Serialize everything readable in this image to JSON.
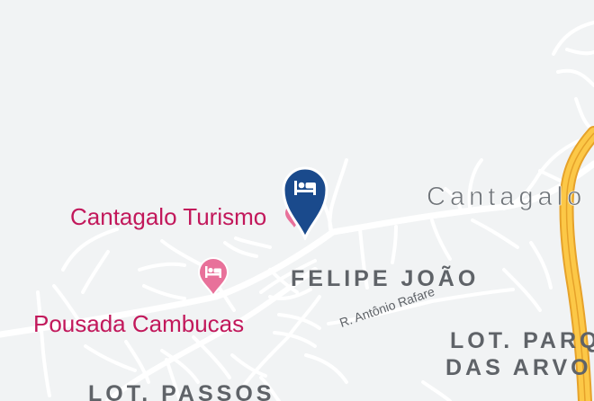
{
  "map": {
    "city_label": "Cantagalo",
    "areas": [
      {
        "name": "FELIPE JOÃO"
      },
      {
        "name": "LOT. PARQUE DAS ARVORES",
        "line1": "LOT. PARQ",
        "line2": "DAS ARVO"
      },
      {
        "name": "LOT. PASSOS"
      }
    ],
    "streets": [
      {
        "name": "R. Antônio Rafare"
      }
    ],
    "places": [
      {
        "name": "Cantagalo Turismo",
        "icon": "hotel-icon",
        "selected": true
      },
      {
        "name": "Pousada Cambucas",
        "icon": "hotel-icon",
        "selected": false
      }
    ],
    "colors": {
      "background": "#f1f3f4",
      "road": "#ffffff",
      "highway": "#fcc847",
      "highway_casing": "#e6a22a",
      "poi_text": "#c2185b",
      "selected_pin": "#1a4a8c",
      "hotel_pin": "#e8719a"
    }
  }
}
